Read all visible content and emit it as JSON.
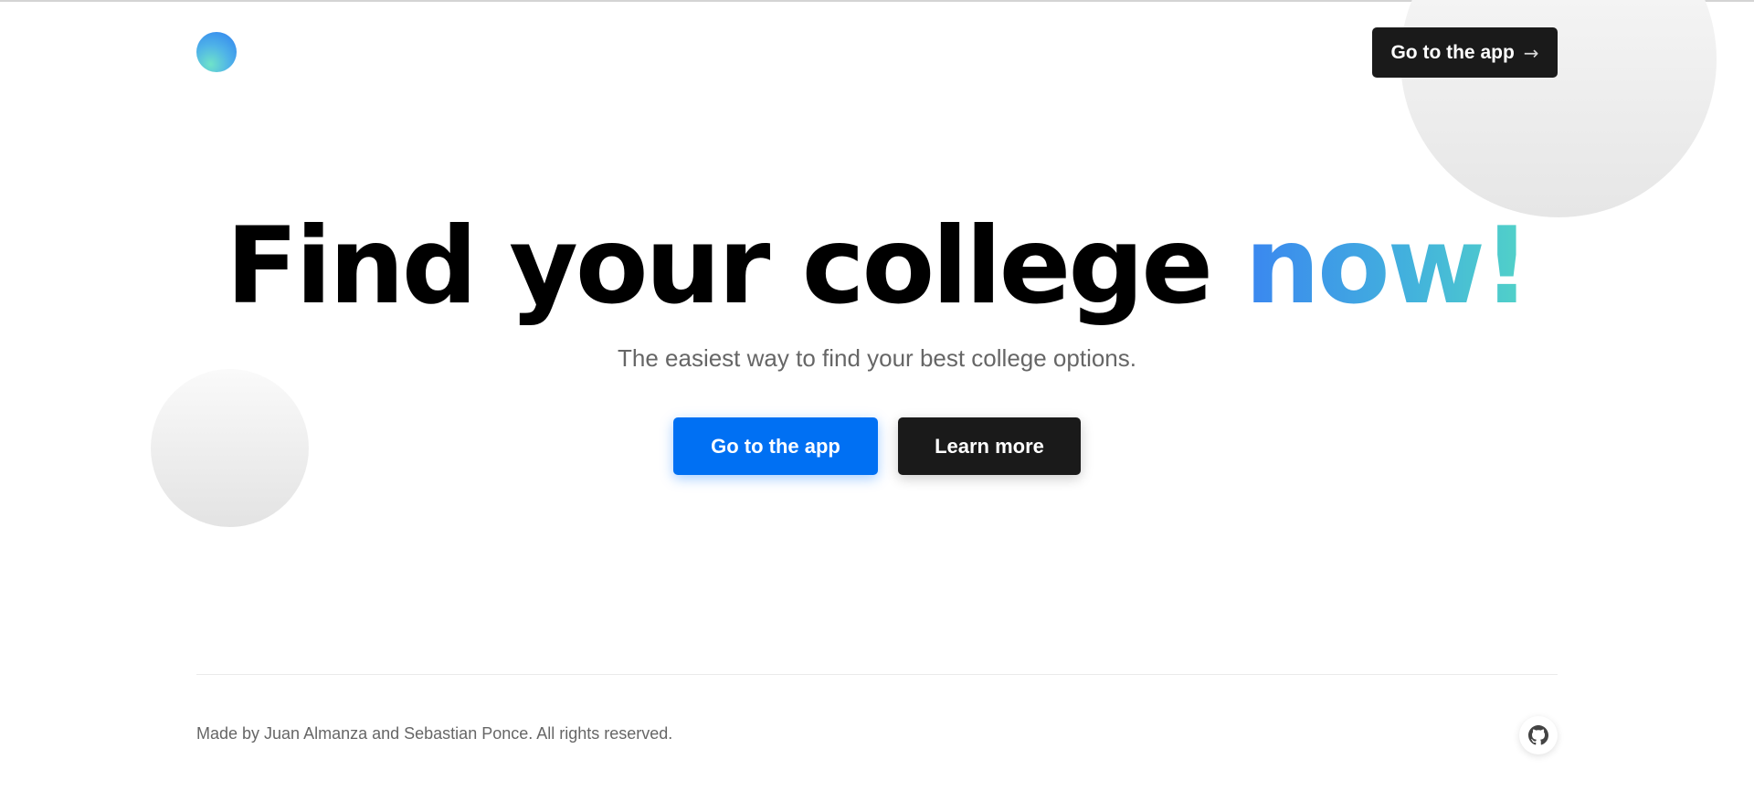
{
  "header": {
    "logo_icon": "gradient-circle-logo",
    "nav_button_label": "Go to the app",
    "nav_button_icon": "arrow-right-icon"
  },
  "hero": {
    "title_main": "Find your college ",
    "title_accent": "now!",
    "subtitle": "The easiest way to find your best college options.",
    "primary_button_label": "Go to the app",
    "secondary_button_label": "Learn more"
  },
  "footer": {
    "credits": "Made by Juan Almanza and Sebastian Ponce. All rights reserved.",
    "github_icon": "github-icon"
  },
  "colors": {
    "primary": "#0070f3",
    "dark": "#1a1a1a",
    "accent_gradient_start": "#3a86f0",
    "accent_gradient_end": "#52d3c7",
    "muted_text": "#666666"
  }
}
